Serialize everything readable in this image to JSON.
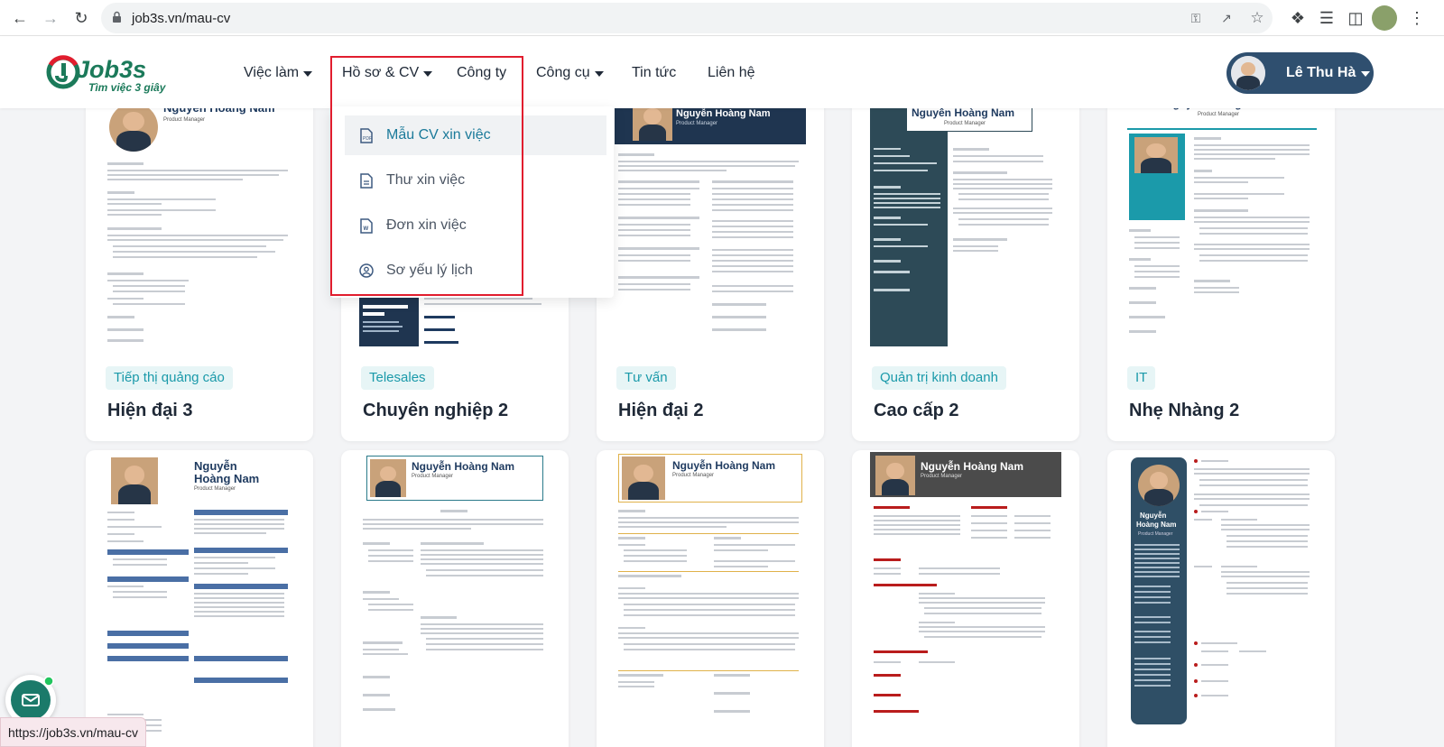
{
  "browser": {
    "url": "job3s.vn/mau-cv",
    "back_icon": "arrow-left-icon",
    "forward_icon": "arrow-right-icon",
    "reload_icon": "reload-icon"
  },
  "header": {
    "logo_text": "Job3s",
    "logo_tagline": "Tìm việc 3 giây",
    "nav": [
      {
        "label": "Việc làm",
        "dropdown": true
      },
      {
        "label": "Hồ sơ & CV",
        "dropdown": true
      },
      {
        "label": "Công ty",
        "dropdown": false
      },
      {
        "label": "Công cụ",
        "dropdown": true
      },
      {
        "label": "Tin tức",
        "dropdown": false
      },
      {
        "label": "Liên hệ",
        "dropdown": false
      }
    ],
    "user_name": "Lê Thu Hà"
  },
  "dropdown": {
    "items": [
      {
        "label": "Mẫu CV xin việc",
        "icon": "pdf-file-icon",
        "active": true
      },
      {
        "label": "Thư xin việc",
        "icon": "document-icon",
        "active": false
      },
      {
        "label": "Đơn xin việc",
        "icon": "word-file-icon",
        "active": false
      },
      {
        "label": "Sơ yếu lý lịch",
        "icon": "user-circle-icon",
        "active": false
      }
    ]
  },
  "cards": [
    {
      "tag": "Tiếp thị quảng cáo",
      "title": "Hiện đại 3"
    },
    {
      "tag": "Telesales",
      "title": "Chuyên nghiệp 2"
    },
    {
      "tag": "Tư vấn",
      "title": "Hiện đại 2"
    },
    {
      "tag": "Quản trị kinh doanh",
      "title": "Cao cấp 2"
    },
    {
      "tag": "IT",
      "title": "Nhẹ Nhàng 2"
    }
  ],
  "cv_preview": {
    "name": "Nguyễn Hoàng Nam",
    "job_title": "Product Manager",
    "name_line1": "Nguyễn",
    "name_line2": "Hoàng Nam"
  },
  "status_url": "https://job3s.vn/mau-cv"
}
